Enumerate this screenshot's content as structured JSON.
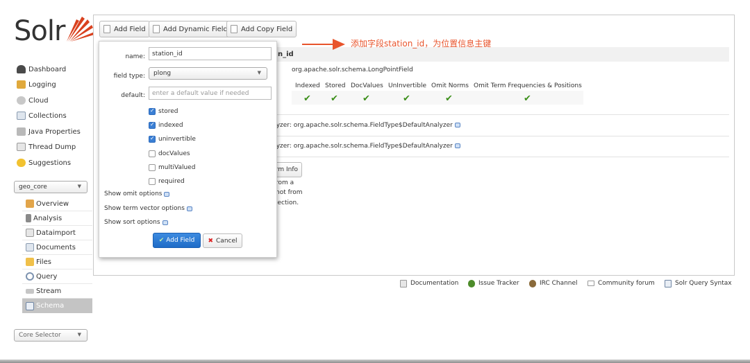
{
  "logo": {
    "text": "Solr"
  },
  "nav": {
    "items": [
      {
        "label": "Dashboard",
        "icon": "dashboard-icon"
      },
      {
        "label": "Logging",
        "icon": "logging-icon"
      },
      {
        "label": "Cloud",
        "icon": "cloud-icon"
      },
      {
        "label": "Collections",
        "icon": "collections-icon"
      },
      {
        "label": "Java Properties",
        "icon": "java-properties-icon"
      },
      {
        "label": "Thread Dump",
        "icon": "thread-dump-icon"
      },
      {
        "label": "Suggestions",
        "icon": "suggestions-icon"
      }
    ],
    "core_select": "geo_core",
    "core_items": [
      {
        "label": "Overview",
        "icon": "overview-icon"
      },
      {
        "label": "Analysis",
        "icon": "analysis-icon"
      },
      {
        "label": "Dataimport",
        "icon": "dataimport-icon"
      },
      {
        "label": "Documents",
        "icon": "documents-icon"
      },
      {
        "label": "Files",
        "icon": "files-icon"
      },
      {
        "label": "Query",
        "icon": "query-icon"
      },
      {
        "label": "Stream",
        "icon": "stream-icon"
      },
      {
        "label": "Schema",
        "icon": "schema-icon",
        "active": true
      }
    ],
    "core_selector": "Core Selector"
  },
  "toolbar": {
    "add_field": "Add Field",
    "add_dynamic_field": "Add Dynamic Field",
    "add_copy_field": "Add Copy Field"
  },
  "background": {
    "field_name_partial": "n_id",
    "field_type_class": "org.apache.solr.schema.LongPointField",
    "flag_headers": [
      "Indexed",
      "Stored",
      "DocValues",
      "UnInvertible",
      "Omit Norms",
      "Omit Term Frequencies & Positions"
    ],
    "index_analyzer": "nalyzer: org.apache.solr.schema.FieldType$DefaultAnalyzer",
    "query_analyzer": "nalyzer: org.apache.solr.schema.FieldType$DefaultAnalyzer",
    "term_info_button": "rm Info",
    "info_line1": "rom a",
    "info_line2": "not from",
    "info_line3": "lection."
  },
  "modal": {
    "name_label": "name:",
    "name_value": "station_id",
    "field_type_label": "field type:",
    "field_type_value": "plong",
    "default_label": "default:",
    "default_placeholder": "enter a default value if needed",
    "checkboxes": [
      {
        "label": "stored",
        "checked": true
      },
      {
        "label": "indexed",
        "checked": true
      },
      {
        "label": "uninvertible",
        "checked": true
      },
      {
        "label": "docValues",
        "checked": false
      },
      {
        "label": "multiValued",
        "checked": false
      },
      {
        "label": "required",
        "checked": false
      }
    ],
    "show_omit": "Show omit options",
    "show_term_vector": "Show term vector options",
    "show_sort": "Show sort options",
    "add_button": "Add Field",
    "cancel_button": "Cancel"
  },
  "annotation": {
    "text": "添加字段station_id，为位置信息主键",
    "color": "#e8542c"
  },
  "footer": {
    "documentation": "Documentation",
    "issue_tracker": "Issue Tracker",
    "irc_channel": "IRC Channel",
    "community_forum": "Community forum",
    "query_syntax": "Solr Query Syntax"
  }
}
